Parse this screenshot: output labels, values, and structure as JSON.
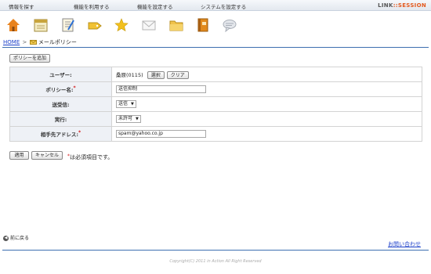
{
  "nav": {
    "items": [
      "情報を探す",
      "機能を利用する",
      "機能を設定する",
      "システムを設定する"
    ],
    "brand_main": "LINK",
    "brand_accent": "::SESSION"
  },
  "icons": [
    "home-icon",
    "calendar-icon",
    "notepad-icon",
    "tag-icon",
    "star-icon",
    "mail-icon",
    "folder-icon",
    "address-book-icon",
    "comment-icon"
  ],
  "breadcrumb": {
    "home": "HOME",
    "separator": ">",
    "current": "メールポリシー"
  },
  "toolbar": {
    "add_policy": "ポリシーを追加"
  },
  "form": {
    "user": {
      "label": "ユーザー:",
      "value": "桑原(0115)",
      "select_btn": "選択",
      "clear_btn": "クリア"
    },
    "policy_name": {
      "label": "ポリシー名:",
      "required": "*",
      "value": "送信抑制"
    },
    "direction": {
      "label": "送受信:",
      "value": "送信"
    },
    "execution": {
      "label": "実行:",
      "value": "未許可"
    },
    "address": {
      "label": "相手先アドレス:",
      "required": "*",
      "value": "spam@yahoo.co.jp"
    }
  },
  "actions": {
    "apply": "適用",
    "cancel": "キャンセル"
  },
  "note": {
    "mark": "*",
    "text": "は必須項目です。"
  },
  "footer": {
    "back": "前に戻る",
    "contact": "お問い合わせ",
    "copyright": "Copyright(C) 2011 in Action All Right Reserved"
  }
}
